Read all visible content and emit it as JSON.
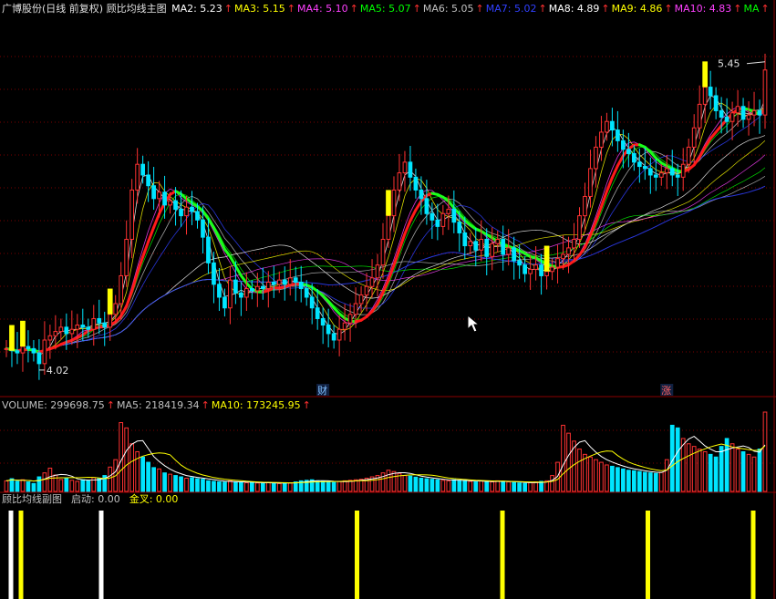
{
  "main_header": {
    "title": "广博股份(日线 前复权) 顾比均线主图",
    "items": [
      {
        "label": "MA2: 5.23",
        "color": "#ffffff"
      },
      {
        "label": "MA3: 5.15",
        "color": "#ffff00"
      },
      {
        "label": "MA4: 5.10",
        "color": "#ff40ff"
      },
      {
        "label": "MA5: 5.07",
        "color": "#00ff00"
      },
      {
        "label": "MA6: 5.05",
        "color": "#c0c0c0"
      },
      {
        "label": "MA7: 5.02",
        "color": "#3040ff"
      },
      {
        "label": "MA8: 4.89",
        "color": "#ffffff"
      },
      {
        "label": "MA9: 4.86",
        "color": "#ffff00"
      },
      {
        "label": "MA10: 4.83",
        "color": "#ff40ff"
      },
      {
        "label": "MA",
        "color": "#00ff00"
      }
    ]
  },
  "volume_header": {
    "items": [
      {
        "label": "VOLUME: 299698.75",
        "color": "#c0c0c0"
      },
      {
        "label": "MA5: 218419.34",
        "color": "#c0c0c0"
      },
      {
        "label": "MA10: 173245.95",
        "color": "#ffff00"
      }
    ]
  },
  "indicator_header": {
    "items": [
      {
        "label": "顾比均线副图",
        "color": "#c0c0c0"
      },
      {
        "label": "启动: 0.00",
        "color": "#c0c0c0"
      },
      {
        "label": "金叉: 0.00",
        "color": "#ffff00"
      }
    ]
  },
  "chart_data": [
    {
      "type": "candlestick",
      "high_label": "5.45",
      "low_label": "4.02",
      "event_markers": [
        "财",
        "涨"
      ],
      "x": [
        0,
        1,
        2,
        3,
        4,
        5,
        6,
        7,
        8,
        9,
        10,
        11,
        12,
        13,
        14,
        15,
        16,
        17,
        18,
        19,
        20,
        21,
        22,
        23,
        24,
        25,
        26,
        27,
        28,
        29,
        30,
        31,
        32,
        33,
        34,
        35,
        36,
        37,
        38,
        39,
        40,
        41,
        42,
        43,
        44,
        45,
        46,
        47,
        48,
        49,
        50,
        51,
        52,
        53,
        54,
        55,
        56,
        57,
        58,
        59,
        60,
        61,
        62,
        63,
        64,
        65,
        66,
        67,
        68,
        69,
        70,
        71,
        72,
        73,
        74,
        75,
        76,
        77,
        78,
        79,
        80,
        81,
        82,
        83,
        84,
        85,
        86,
        87,
        88,
        89,
        90,
        91,
        92,
        93,
        94,
        95,
        96,
        97,
        98,
        99,
        100,
        101,
        102,
        103,
        104,
        105,
        106,
        107,
        108,
        109,
        110,
        111,
        112,
        113,
        114,
        115,
        116,
        117,
        118,
        119,
        120,
        121,
        122,
        123,
        124,
        125,
        126,
        127,
        128,
        129,
        130,
        131,
        132,
        133,
        134,
        135,
        136,
        137,
        138,
        139
      ],
      "close": [
        4.12,
        4.11,
        4.1,
        4.13,
        4.12,
        4.1,
        4.05,
        4.16,
        4.18,
        4.2,
        4.22,
        4.19,
        4.21,
        4.23,
        4.22,
        4.21,
        4.26,
        4.24,
        4.22,
        4.28,
        4.33,
        4.46,
        4.63,
        4.86,
        4.98,
        4.93,
        4.88,
        4.82,
        4.85,
        4.79,
        4.81,
        4.77,
        4.74,
        4.78,
        4.76,
        4.72,
        4.64,
        4.52,
        4.42,
        4.36,
        4.31,
        4.44,
        4.38,
        4.36,
        4.4,
        4.39,
        4.41,
        4.4,
        4.43,
        4.42,
        4.44,
        4.42,
        4.45,
        4.43,
        4.4,
        4.36,
        4.31,
        4.26,
        4.23,
        4.19,
        4.16,
        4.21,
        4.24,
        4.28,
        4.33,
        4.37,
        4.41,
        4.45,
        4.51,
        4.63,
        4.74,
        4.86,
        4.94,
        4.99,
        4.92,
        4.86,
        4.82,
        4.75,
        4.72,
        4.69,
        4.75,
        4.77,
        4.71,
        4.66,
        4.6,
        4.62,
        4.58,
        4.63,
        4.55,
        4.61,
        4.63,
        4.56,
        4.59,
        4.53,
        4.51,
        4.47,
        4.49,
        4.51,
        4.46,
        4.48,
        4.5,
        4.54,
        4.56,
        4.59,
        4.63,
        4.74,
        4.83,
        4.96,
        5.06,
        5.13,
        5.18,
        5.14,
        5.09,
        5.05,
        5.03,
        4.99,
        4.97,
        4.96,
        4.93,
        4.92,
        4.94,
        4.96,
        4.93,
        4.92,
        4.98,
        5.06,
        5.15,
        5.26,
        5.34,
        5.3,
        5.23,
        5.2,
        5.18,
        5.22,
        5.25,
        5.19,
        5.21,
        5.23,
        5.21,
        5.42
      ],
      "volume": [
        40,
        48,
        38,
        44,
        36,
        30,
        55,
        70,
        88,
        62,
        45,
        50,
        42,
        38,
        44,
        40,
        52,
        48,
        60,
        92,
        120,
        260,
        240,
        180,
        150,
        130,
        110,
        90,
        85,
        70,
        65,
        60,
        55,
        50,
        52,
        48,
        46,
        40,
        38,
        36,
        35,
        40,
        36,
        34,
        33,
        35,
        32,
        30,
        34,
        31,
        30,
        33,
        32,
        36,
        40,
        42,
        44,
        40,
        38,
        36,
        34,
        38,
        40,
        42,
        44,
        46,
        50,
        55,
        60,
        70,
        80,
        75,
        68,
        60,
        58,
        54,
        50,
        48,
        46,
        44,
        42,
        40,
        44,
        42,
        40,
        38,
        36,
        40,
        38,
        36,
        40,
        38,
        36,
        34,
        32,
        30,
        34,
        36,
        38,
        40,
        60,
        110,
        250,
        220,
        190,
        160,
        140,
        130,
        120,
        110,
        100,
        95,
        90,
        85,
        80,
        78,
        75,
        72,
        70,
        68,
        72,
        120,
        250,
        240,
        200,
        180,
        170,
        160,
        150,
        140,
        130,
        170,
        200,
        180,
        160,
        150,
        140,
        130,
        160,
        299.7
      ]
    },
    {
      "type": "bar",
      "title": "顾比均线副图",
      "series": [
        {
          "name": "启动",
          "x": [
            1,
            19
          ],
          "values": [
            1,
            1
          ]
        },
        {
          "name": "金叉",
          "x": [
            3,
            70,
            99,
            128,
            149
          ],
          "values": [
            1,
            1,
            1,
            1,
            1
          ]
        }
      ]
    }
  ]
}
